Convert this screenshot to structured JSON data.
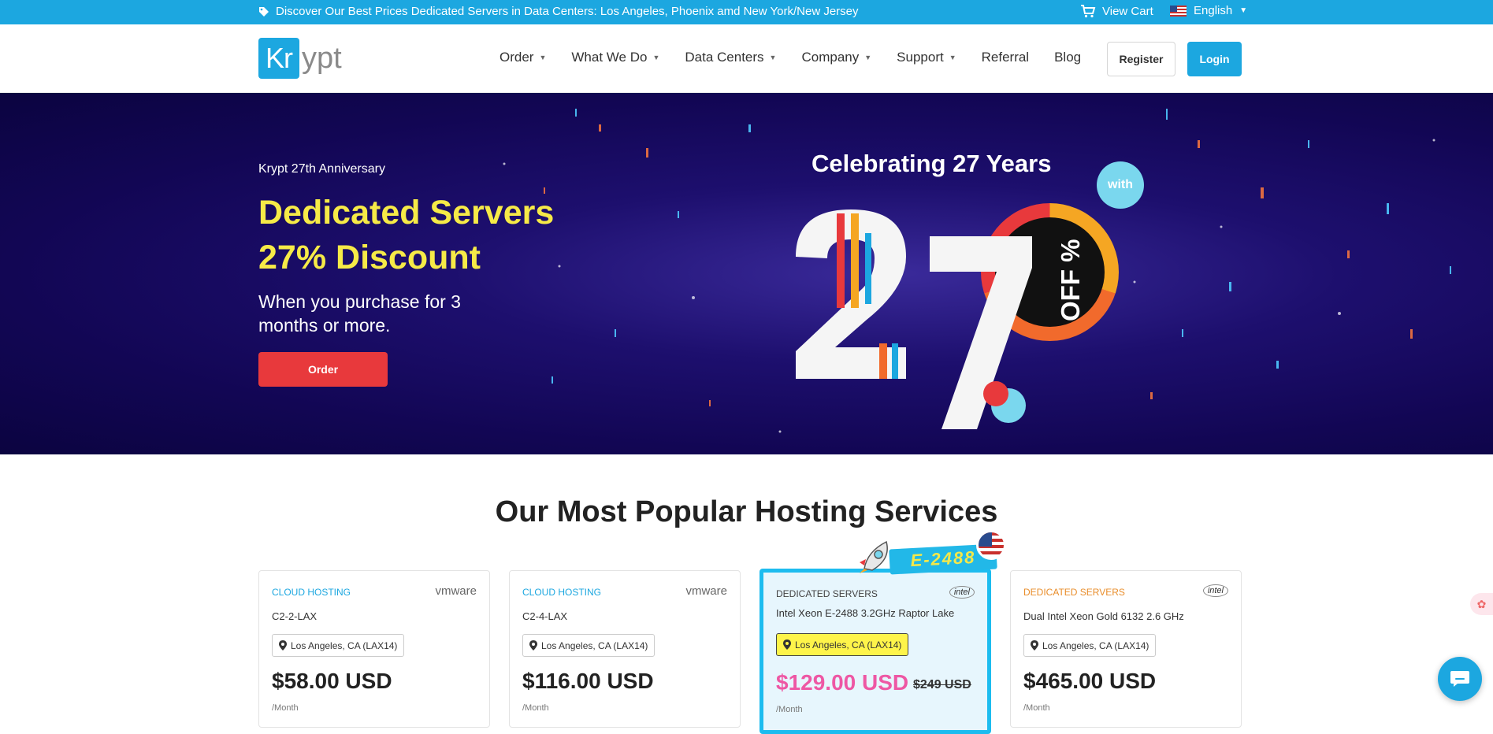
{
  "topbar": {
    "promo_text": "Discover Our Best Prices Dedicated Servers in Data Centers: Los Angeles, Phoenix amd New York/New Jersey",
    "promo_icon": "tag-icon",
    "cart_label": "View Cart",
    "cart_icon": "cart-icon",
    "language": "English"
  },
  "header": {
    "logo_kr": "Kr",
    "logo_rest": "ypt",
    "nav": [
      {
        "label": "Order",
        "dropdown": true
      },
      {
        "label": "What We Do",
        "dropdown": true
      },
      {
        "label": "Data Centers",
        "dropdown": true
      },
      {
        "label": "Company",
        "dropdown": true
      },
      {
        "label": "Support",
        "dropdown": true
      },
      {
        "label": "Referral",
        "dropdown": false
      },
      {
        "label": "Blog",
        "dropdown": false
      }
    ],
    "register_label": "Register",
    "login_label": "Login"
  },
  "hero": {
    "eyebrow": "Krypt 27th Anniversary",
    "headline_1": "Dedicated Servers",
    "headline_2": "27% Discount",
    "sub": "When you purchase for 3 months or more.",
    "order_label": "Order",
    "celebrate": "Celebrating 27 Years",
    "with": "with",
    "big_number_1": "2",
    "big_number_2": "7",
    "off_label": "OFF %"
  },
  "section": {
    "title": "Our Most Popular Hosting Services"
  },
  "badge": {
    "label": "E-2488"
  },
  "cards": [
    {
      "category": "CLOUD HOSTING",
      "brand": "vmware",
      "name": "C2-2-LAX",
      "location": "Los Angeles, CA (LAX14)",
      "price": "$58.00 USD",
      "old_price": "",
      "period": "/Month"
    },
    {
      "category": "CLOUD HOSTING",
      "brand": "vmware",
      "name": "C2-4-LAX",
      "location": "Los Angeles, CA (LAX14)",
      "price": "$116.00 USD",
      "old_price": "",
      "period": "/Month"
    },
    {
      "category": "DEDICATED SERVERS",
      "brand": "intel",
      "name": "Intel Xeon E-2488 3.2GHz Raptor Lake",
      "location": "Los Angeles, CA (LAX14)",
      "price": "$129.00 USD",
      "old_price": "$249 USD",
      "period": "/Month"
    },
    {
      "category": "DEDICATED SERVERS",
      "brand": "intel",
      "name": "Dual Intel Xeon Gold 6132 2.6 GHz",
      "location": "Los Angeles, CA (LAX14)",
      "price": "$465.00 USD",
      "old_price": "",
      "period": "/Month"
    }
  ],
  "colors": {
    "brand_blue": "#1ca7e0",
    "hero_yellow": "#f6ea47",
    "order_red": "#e8393c",
    "featured_pink": "#ee57a4"
  }
}
